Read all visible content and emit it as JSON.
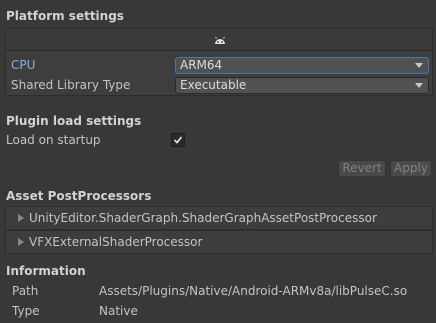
{
  "platform_settings": {
    "header": "Platform settings",
    "tab_icon": "android-icon",
    "cpu": {
      "label": "CPU",
      "value": "ARM64"
    },
    "shared_library_type": {
      "label": "Shared Library Type",
      "value": "Executable"
    }
  },
  "plugin_load_settings": {
    "header": "Plugin load settings",
    "load_on_startup": {
      "label": "Load on startup",
      "checked": true
    }
  },
  "buttons": {
    "revert": "Revert",
    "apply": "Apply"
  },
  "asset_postprocessors": {
    "header": "Asset PostProcessors",
    "items": [
      "UnityEditor.ShaderGraph.ShaderGraphAssetPostProcessor",
      "VFXExternalShaderProcessor"
    ]
  },
  "information": {
    "header": "Information",
    "path": {
      "label": "Path",
      "value": "Assets/Plugins/Native/Android-ARMv8a/libPulseC.so"
    },
    "type": {
      "label": "Type",
      "value": "Native"
    }
  },
  "colors": {
    "background": "#383838",
    "accent": "#7fb3ea",
    "focus_border": "#3a79bb"
  }
}
